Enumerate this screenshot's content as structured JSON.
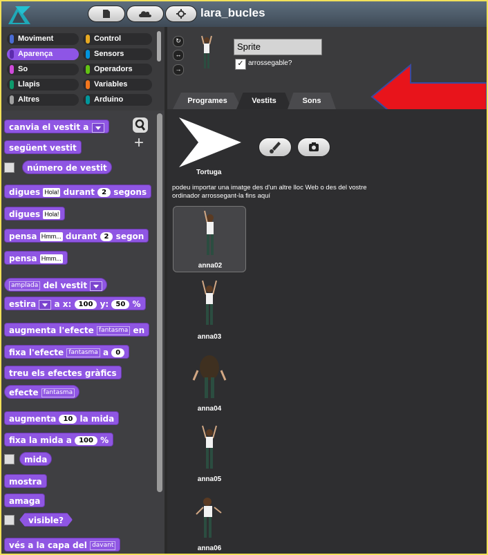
{
  "project": {
    "title": "lara_bucles"
  },
  "categories": [
    {
      "label": "Moviment",
      "color": "#4a6cd4",
      "selected": false
    },
    {
      "label": "Control",
      "color": "#e6a822",
      "selected": false
    },
    {
      "label": "Aparença",
      "color": "#8f56e3",
      "selected": true
    },
    {
      "label": "Sensors",
      "color": "#0094dd",
      "selected": false
    },
    {
      "label": "So",
      "color": "#cf4ad9",
      "selected": false
    },
    {
      "label": "Operadors",
      "color": "#62c213",
      "selected": false
    },
    {
      "label": "Llapis",
      "color": "#0e9a6c",
      "selected": false
    },
    {
      "label": "Variables",
      "color": "#f3761d",
      "selected": false
    },
    {
      "label": "Altres",
      "color": "#a0a0a0",
      "selected": false
    },
    {
      "label": "Arduino",
      "color": "#00979c",
      "selected": false
    }
  ],
  "blocks": {
    "switch_costume": "canvia el vestit a",
    "next_costume": "següent vestit",
    "costume_number": "número de vestit",
    "say_for_1": "digues",
    "say_for_val": "Hola!",
    "say_for_2": "durant",
    "say_for_secs": "2",
    "say_for_3": "segons",
    "say": "digues",
    "say_val": "Hola!",
    "think_for_1": "pensa",
    "think_for_val": "Hmm...",
    "think_for_2": "durant",
    "think_for_secs": "2",
    "think_for_3": "segon",
    "think": "pensa",
    "think_val": "Hmm...",
    "attr_dd": "amplada",
    "attr_of": "del vestit",
    "stretch_1": "estira",
    "stretch_x": "a x:",
    "stretch_xval": "100",
    "stretch_y": "y:",
    "stretch_yval": "50",
    "stretch_tail": "%",
    "change_effect": "augmenta l'efecte",
    "change_effect_dd": "fantasma",
    "change_effect_tail": "en",
    "set_effect": "fixa l'efecte",
    "set_effect_dd": "fantasma",
    "set_effect_a": "a",
    "set_effect_val": "0",
    "clear_effects": "treu els efectes gràfics",
    "effect": "efecte",
    "effect_dd": "fantasma",
    "change_size": "augmenta",
    "change_size_val": "10",
    "change_size_tail": "la mida",
    "set_size": "fixa la mida a",
    "set_size_val": "100",
    "set_size_tail": "%",
    "size": "mida",
    "show": "mostra",
    "hide": "amaga",
    "visible": "visible?",
    "go_layer": "vés a la capa del",
    "go_layer_dd": "davant"
  },
  "sprite": {
    "name": "Sprite",
    "draggable_label": "arrossegable?",
    "draggable_checked": "✓"
  },
  "tabs": [
    {
      "label": "Programes",
      "selected": false
    },
    {
      "label": "Vestits",
      "selected": true
    },
    {
      "label": "Sons",
      "selected": false
    }
  ],
  "costumes": {
    "turtle": "Tortuga",
    "info": "podeu importar una imatge des d'un altre lloc Web o des del vostre ordinador arrossegant-la fins aquí",
    "items": [
      {
        "label": "anna02",
        "selected": true
      },
      {
        "label": "anna03",
        "selected": false
      },
      {
        "label": "anna04",
        "selected": false
      },
      {
        "label": "anna05",
        "selected": false
      },
      {
        "label": "anna06",
        "selected": false
      }
    ]
  },
  "colors": {
    "looks": "#8f56e3",
    "annotation_arrow": "#e8141b"
  }
}
